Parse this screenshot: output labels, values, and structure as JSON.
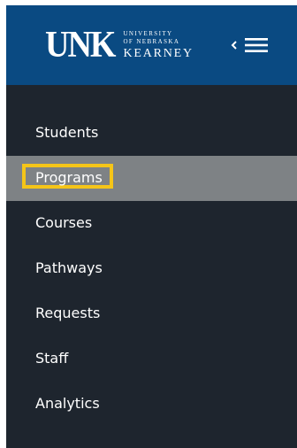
{
  "header": {
    "logo": {
      "mark": "UNK",
      "line1": "UNIVERSITY",
      "line2": "OF NEBRASKA",
      "line3": "KEARNEY"
    },
    "collapse_icon": "chevron-left-icon",
    "menu_icon": "hamburger-menu-icon"
  },
  "nav": {
    "items": [
      {
        "label": "Students"
      },
      {
        "label": "Programs",
        "active": true
      },
      {
        "label": "Courses"
      },
      {
        "label": "Pathways"
      },
      {
        "label": "Requests"
      },
      {
        "label": "Staff"
      },
      {
        "label": "Analytics"
      }
    ]
  },
  "colors": {
    "header_bg": "#0a4a82",
    "sidebar_bg": "#1e252e",
    "active_bg": "#7e8285",
    "highlight": "#f5c518"
  }
}
